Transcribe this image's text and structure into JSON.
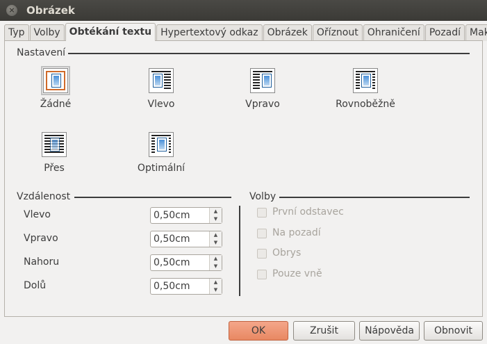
{
  "window": {
    "title": "Obrázek",
    "close_glyph": "×"
  },
  "tabs": [
    {
      "label": "Typ",
      "active": false
    },
    {
      "label": "Volby",
      "active": false
    },
    {
      "label": "Obtékání textu",
      "active": true
    },
    {
      "label": "Hypertextový odkaz",
      "active": false
    },
    {
      "label": "Obrázek",
      "active": false
    },
    {
      "label": "Oříznout",
      "active": false
    },
    {
      "label": "Ohraničení",
      "active": false
    },
    {
      "label": "Pozadí",
      "active": false
    },
    {
      "label": "Makro",
      "active": false
    }
  ],
  "settings": {
    "title": "Nastavení",
    "options": [
      {
        "label": "Žádné",
        "icon": "wrap-none-icon",
        "selected": true
      },
      {
        "label": "Vlevo",
        "icon": "wrap-left-icon",
        "selected": false
      },
      {
        "label": "Vpravo",
        "icon": "wrap-right-icon",
        "selected": false
      },
      {
        "label": "Rovnoběžně",
        "icon": "wrap-parallel-icon",
        "selected": false
      },
      {
        "label": "Přes",
        "icon": "wrap-through-icon",
        "selected": false
      },
      {
        "label": "Optimální",
        "icon": "wrap-optimal-icon",
        "selected": false
      }
    ]
  },
  "spacing": {
    "title": "Vzdálenost",
    "rows": [
      {
        "label": "Vlevo",
        "value": "0,50cm"
      },
      {
        "label": "Vpravo",
        "value": "0,50cm"
      },
      {
        "label": "Nahoru",
        "value": "0,50cm"
      },
      {
        "label": "Dolů",
        "value": "0,50cm"
      }
    ],
    "spin_up_glyph": "▲",
    "spin_down_glyph": "▼"
  },
  "options": {
    "title": "Volby",
    "items": [
      {
        "label": "První odstavec",
        "checked": false,
        "enabled": false
      },
      {
        "label": "Na pozadí",
        "checked": false,
        "enabled": false
      },
      {
        "label": "Obrys",
        "checked": false,
        "enabled": false
      },
      {
        "label": "Pouze vně",
        "checked": false,
        "enabled": false
      }
    ]
  },
  "buttons": {
    "ok": "OK",
    "cancel": "Zrušit",
    "help": "Nápověda",
    "reset": "Obnovit"
  },
  "colors": {
    "default_button": "#e88862",
    "titlebar": "#3b3a36"
  }
}
